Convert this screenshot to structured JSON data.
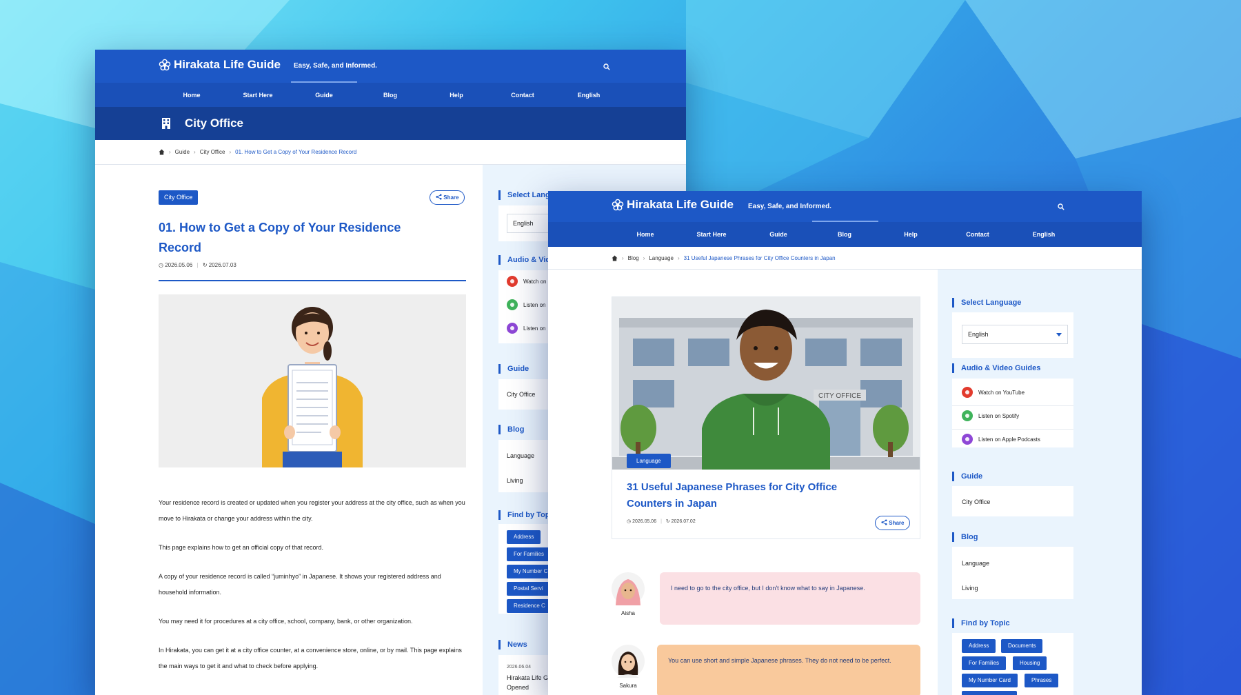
{
  "brand": {
    "name": "Hirakata Life Guide",
    "tagline": "Easy, Safe, and Informed."
  },
  "colors": {
    "primary": "#1d58c6",
    "nav": "#1a50b8",
    "title_bar": "#154095",
    "sidebar_bg": "#eaf4fd",
    "youtube": "#e23b2e",
    "spotify": "#3fb35b",
    "podcasts": "#8e47d6",
    "bubble_pink": "#fbe0e4",
    "bubble_peach": "#f9c99c"
  },
  "nav": [
    "Home",
    "Start Here",
    "Guide",
    "Blog",
    "Help",
    "Contact",
    "English"
  ],
  "icons": {
    "logo": "flower-icon",
    "search": "search-icon",
    "home": "home-icon",
    "building": "building-icon",
    "share": "share-icon",
    "calendar": "clock-icon",
    "updated": "refresh-icon"
  },
  "window1": {
    "page_title": "City Office",
    "breadcrumb": [
      "Guide",
      "City Office",
      "01. How to Get a Copy of Your Residence Record"
    ],
    "category": "City Office",
    "share": "Share",
    "title_line1": "01. How to Get a Copy of Your Residence",
    "title_line2": "Record",
    "published": "2026.05.06",
    "updated": "2026.07.03",
    "paragraphs": [
      "Your residence record is created or updated when you register your address at the city office, such as when you move to Hirakata or change your address within the city.",
      "This page explains how to get an official copy of that record.",
      "A copy of your residence record is called “juminhyo” in Japanese. It shows your registered address and household information.",
      "You may need it for procedures at a city office, school, company, bank, or other organization.",
      "In Hirakata, you can get it at a city office counter, at a convenience store, online, or by mail. This page explains the main ways to get it and what to check before applying."
    ],
    "sidebar": {
      "select_language": "Select Lang",
      "language_value": "English",
      "audio_title": "Audio & Vid",
      "audio_items": [
        "Watch on",
        "Listen on",
        "Listen on"
      ],
      "guide_title": "Guide",
      "guide_items": [
        "City Office"
      ],
      "blog_title": "Blog",
      "blog_items": [
        "Language",
        "Living"
      ],
      "topic_title": "Find by Top",
      "topics": [
        "Address",
        "For Families",
        "My Number C",
        "Postal Servi",
        "Residence C"
      ],
      "news_title": "News",
      "news_date": "2026.06.04",
      "news_line1": "Hirakata Life G",
      "news_line2": "Opened"
    }
  },
  "window2": {
    "breadcrumb": [
      "Blog",
      "Language",
      "31 Useful Japanese Phrases for City Office Counters in Japan"
    ],
    "hero_sign": "CITY OFFICE",
    "category": "Language",
    "title_line1": "31 Useful Japanese Phrases for City Office",
    "title_line2": "Counters in Japan",
    "published": "2026.05.06",
    "updated": "2026.07.02",
    "share": "Share",
    "conversation": [
      {
        "name": "Aisha",
        "text": "I need to go to the city office, but I don't know what to say in Japanese."
      },
      {
        "name": "Sakura",
        "text": "You can use short and simple Japanese phrases. They do not need to be perfect."
      }
    ],
    "sidebar": {
      "select_language": "Select Language",
      "language_value": "English",
      "audio_title": "Audio & Video Guides",
      "audio_items": [
        "Watch on YouTube",
        "Listen on Spotify",
        "Listen on Apple Podcasts"
      ],
      "guide_title": "Guide",
      "guide_items": [
        "City Office"
      ],
      "blog_title": "Blog",
      "blog_items": [
        "Language",
        "Living"
      ],
      "topic_title": "Find by Topic",
      "topics": [
        "Address",
        "Documents",
        "For Families",
        "Housing",
        "My Number Card",
        "Phrases"
      ]
    }
  }
}
